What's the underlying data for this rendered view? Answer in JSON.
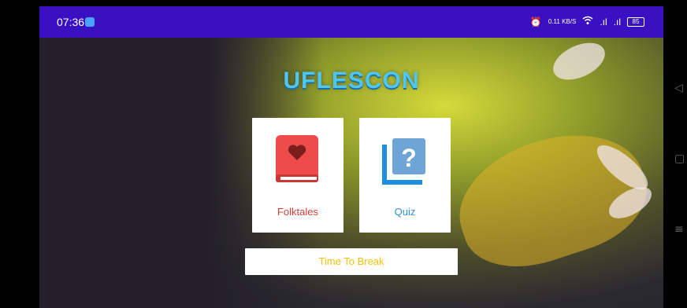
{
  "status": {
    "time": "07:36",
    "right": [
      "⏰",
      "0.11 KB/S",
      "wifi",
      ".ıl",
      ".ıl"
    ],
    "battery": "85"
  },
  "app": {
    "title": "UFLESCON"
  },
  "menu": {
    "folktales_label": "Folktales",
    "quiz_label": "Quiz",
    "break_label": "Time To Break"
  },
  "colors": {
    "statusbar": "#3a11c2",
    "title": "#4fc6f1",
    "folktales": "#d6403a",
    "quiz": "#2f8fd7",
    "break": "#f2c20f"
  },
  "icons": {
    "folktales": "book-heart-icon",
    "quiz": "question-card-icon",
    "nav_back": "back-triangle-icon",
    "nav_home": "home-square-icon",
    "nav_recents": "menu-icon"
  }
}
